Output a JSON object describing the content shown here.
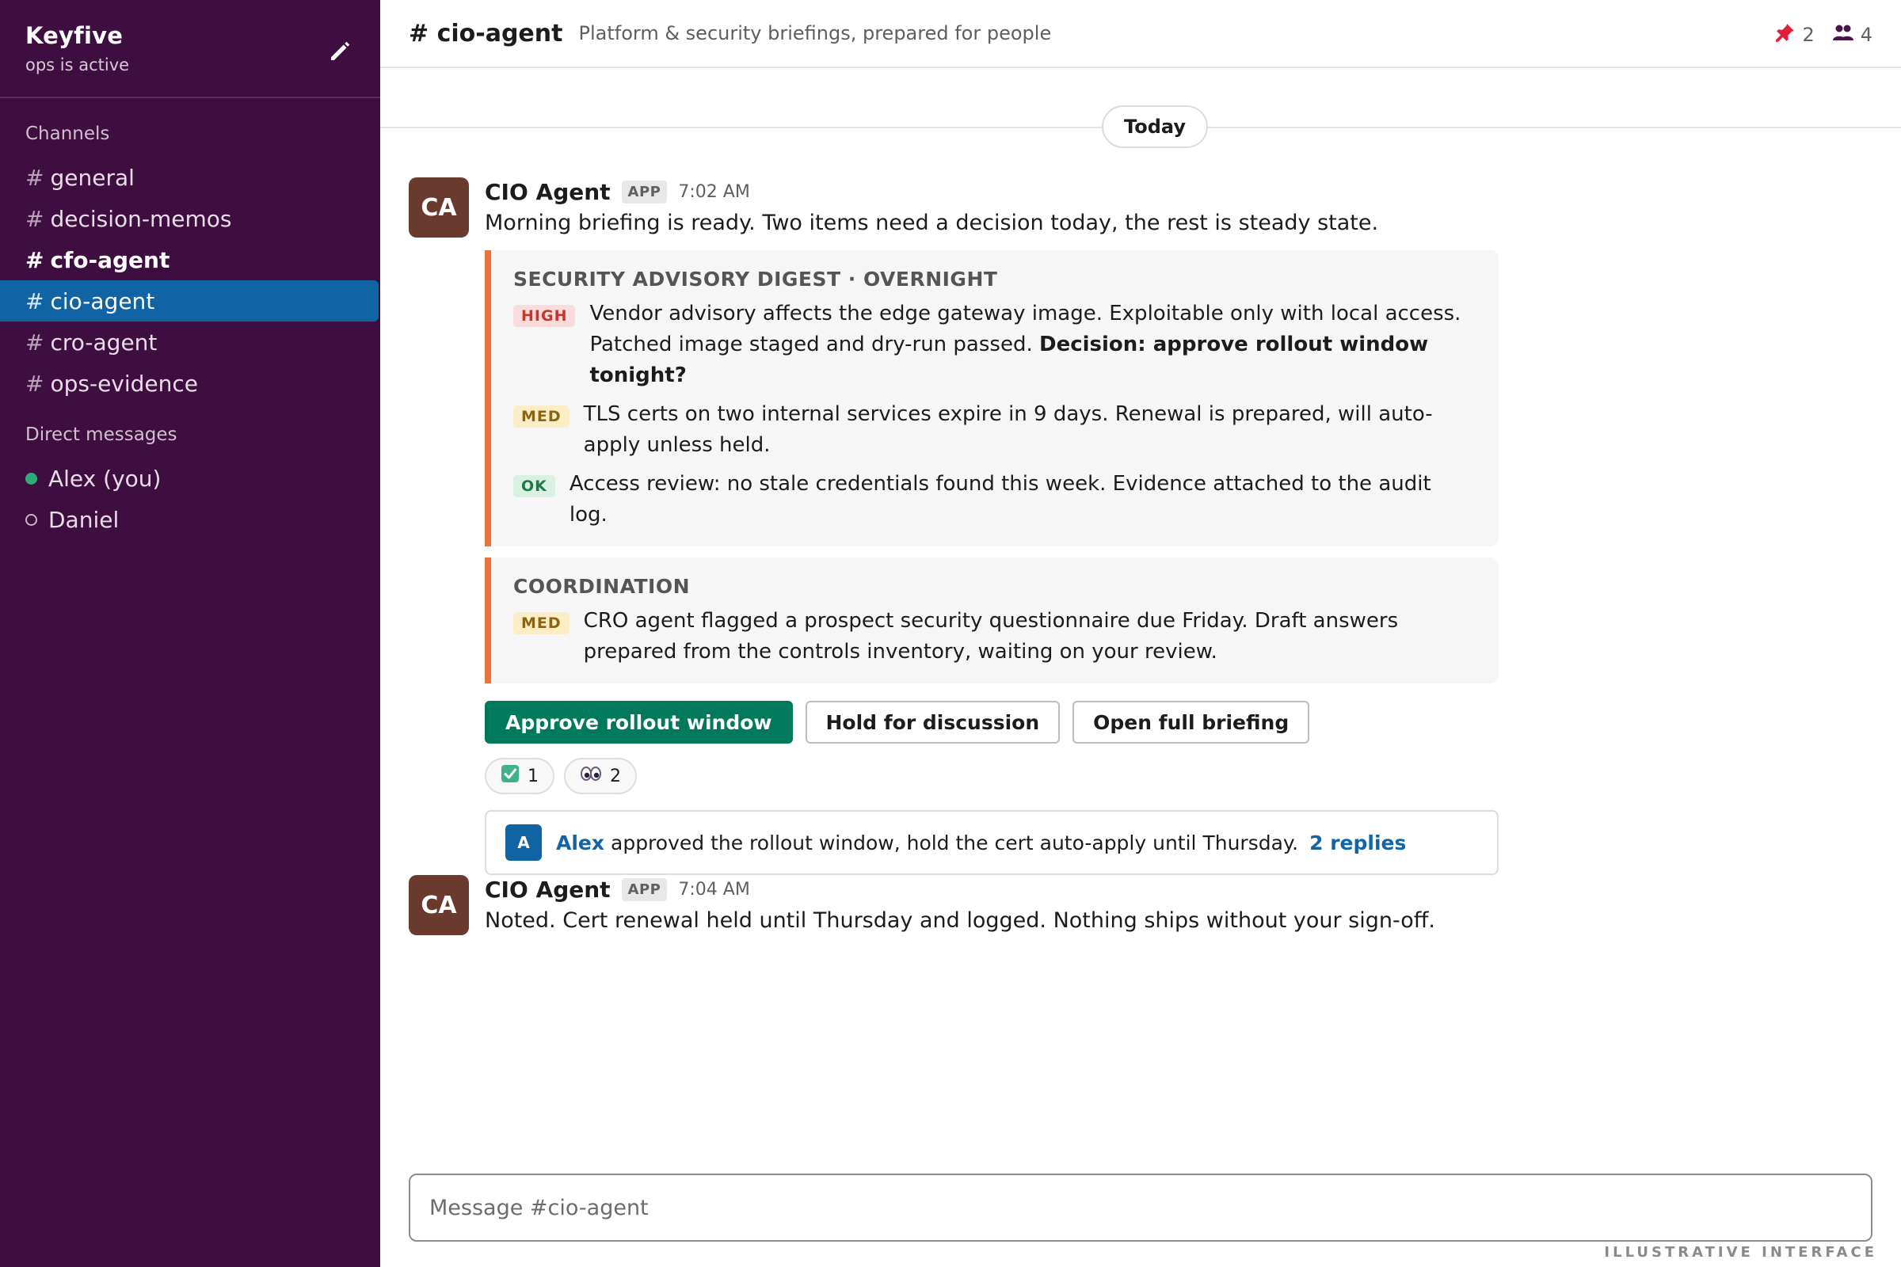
{
  "workspace": {
    "name": "Keyfive",
    "status": "ops is active"
  },
  "sidebar": {
    "channels_label": "Channels",
    "channels": [
      {
        "name": "general",
        "bold": false,
        "active": false
      },
      {
        "name": "decision-memos",
        "bold": false,
        "active": false
      },
      {
        "name": "cfo-agent",
        "bold": true,
        "active": false
      },
      {
        "name": "cio-agent",
        "bold": false,
        "active": true
      },
      {
        "name": "cro-agent",
        "bold": false,
        "active": false
      },
      {
        "name": "ops-evidence",
        "bold": false,
        "active": false
      }
    ],
    "dms_label": "Direct messages",
    "dms": [
      {
        "name": "Alex (you)",
        "presence": "online"
      },
      {
        "name": "Daniel",
        "presence": "away"
      }
    ]
  },
  "channel": {
    "title": "# cio-agent",
    "topic": "Platform & security briefings, prepared for people",
    "pinned_count": "2",
    "member_count": "4"
  },
  "day_divider": "Today",
  "messages": [
    {
      "avatar": "CA",
      "author": "CIO Agent",
      "badge": "APP",
      "time": "7:02 AM",
      "text": "Morning briefing is ready. Two items need a decision today, the rest is steady state.",
      "cards": [
        {
          "title": "SECURITY ADVISORY DIGEST · OVERNIGHT",
          "items": [
            {
              "tag": "HIGH",
              "level": "high",
              "text": "Vendor advisory affects the edge gateway image. Exploitable only with local access. Patched image staged and dry-run passed.",
              "bold": "Decision: approve rollout window tonight?"
            },
            {
              "tag": "MED",
              "level": "med",
              "text": "TLS certs on two internal services expire in 9 days. Renewal is prepared, will auto-apply unless held.",
              "bold": ""
            },
            {
              "tag": "OK",
              "level": "ok",
              "text": "Access review: no stale credentials found this week. Evidence attached to the audit log.",
              "bold": ""
            }
          ]
        },
        {
          "title": "COORDINATION",
          "items": [
            {
              "tag": "MED",
              "level": "med",
              "text": "CRO agent flagged a prospect security questionnaire due Friday. Draft answers prepared from the controls inventory, waiting on your review.",
              "bold": ""
            }
          ]
        }
      ],
      "actions": {
        "approve": "Approve rollout window",
        "hold": "Hold for discussion",
        "open": "Open full briefing"
      },
      "reactions": [
        {
          "icon": "check-box-icon",
          "count": "1"
        },
        {
          "icon": "eyes-icon",
          "count": "2"
        }
      ],
      "thread": {
        "avatar": "A",
        "author": "Alex",
        "text": "approved the rollout window, hold the cert auto-apply until Thursday.",
        "replies": "2 replies"
      }
    },
    {
      "avatar": "CA",
      "author": "CIO Agent",
      "badge": "APP",
      "time": "7:04 AM",
      "text": "Noted. Cert renewal held until Thursday and logged. Nothing ships without your sign-off."
    }
  ],
  "composer": {
    "placeholder": "Message #cio-agent"
  },
  "watermark": "ILLUSTRATIVE INTERFACE",
  "colors": {
    "sidebar_bg": "#3f0e40",
    "active_channel": "#1164a3",
    "primary_button": "#007a5a",
    "card_accent": "#e8743b",
    "avatar_agent": "#6b3a2f"
  }
}
